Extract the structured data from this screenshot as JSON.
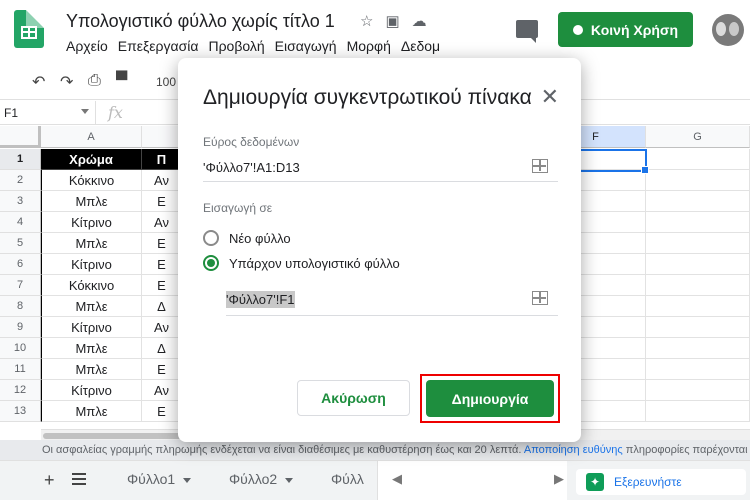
{
  "app": {
    "doc_title": "Υπολογιστικό φύλλο χωρίς τίτλο 1",
    "menu": [
      "Αρχείο",
      "Επεξεργασία",
      "Προβολή",
      "Εισαγωγή",
      "Μορφή",
      "Δεδομ"
    ],
    "share_label": "Κοινή Χρήση",
    "zoom": "100",
    "name_box": "F1",
    "fx_label": "fx"
  },
  "sheet": {
    "columns": [
      "A",
      "F",
      "G"
    ],
    "row_numbers": [
      "1",
      "2",
      "3",
      "4",
      "5",
      "6",
      "7",
      "8",
      "9",
      "10",
      "11",
      "12",
      "13"
    ],
    "header_row": [
      "Χρώμα",
      "Π"
    ],
    "colA": [
      "Κόκκινο",
      "Μπλε",
      "Κίτρινο",
      "Μπλε",
      "Κίτρινο",
      "Κόκκινο",
      "Μπλε",
      "Κίτρινο",
      "Μπλε",
      "Μπλε",
      "Κίτρινο",
      "Μπλε"
    ],
    "colB": [
      "Αν",
      "Ε",
      "Αν",
      "Ε",
      "Ε",
      "Ε",
      "Δ",
      "Αν",
      "Δ",
      "Ε",
      "Αν",
      "Ε"
    ]
  },
  "notice": {
    "text": "Οι ασφαλείας γραμμής πληρωμής ενδέχεται να είναι διαθέσιμες με καθυστέρηση έως και 20 λεπτά.",
    "link": "Αποποίηση ευθύνης",
    "tail": "πληροφορίες παρέχονται \"ως έχουν"
  },
  "tabs": {
    "sheets": [
      "Φύλλο1",
      "Φύλλο2",
      "Φύλλ"
    ],
    "explore": "Εξερευνήστε"
  },
  "dialog": {
    "title": "Δημιουργία συγκεντρωτικού πίνακα",
    "range_label": "Εύρος δεδομένων",
    "range_value": "'Φύλλο7'!A1:D13",
    "insert_label": "Εισαγωγή σε",
    "option_new": "Νέο φύλλο",
    "option_existing": "Υπάρχον υπολογιστικό φύλλο",
    "dest_value": "'Φύλλο7'!F1",
    "cancel": "Ακύρωση",
    "create": "Δημιουργία"
  }
}
